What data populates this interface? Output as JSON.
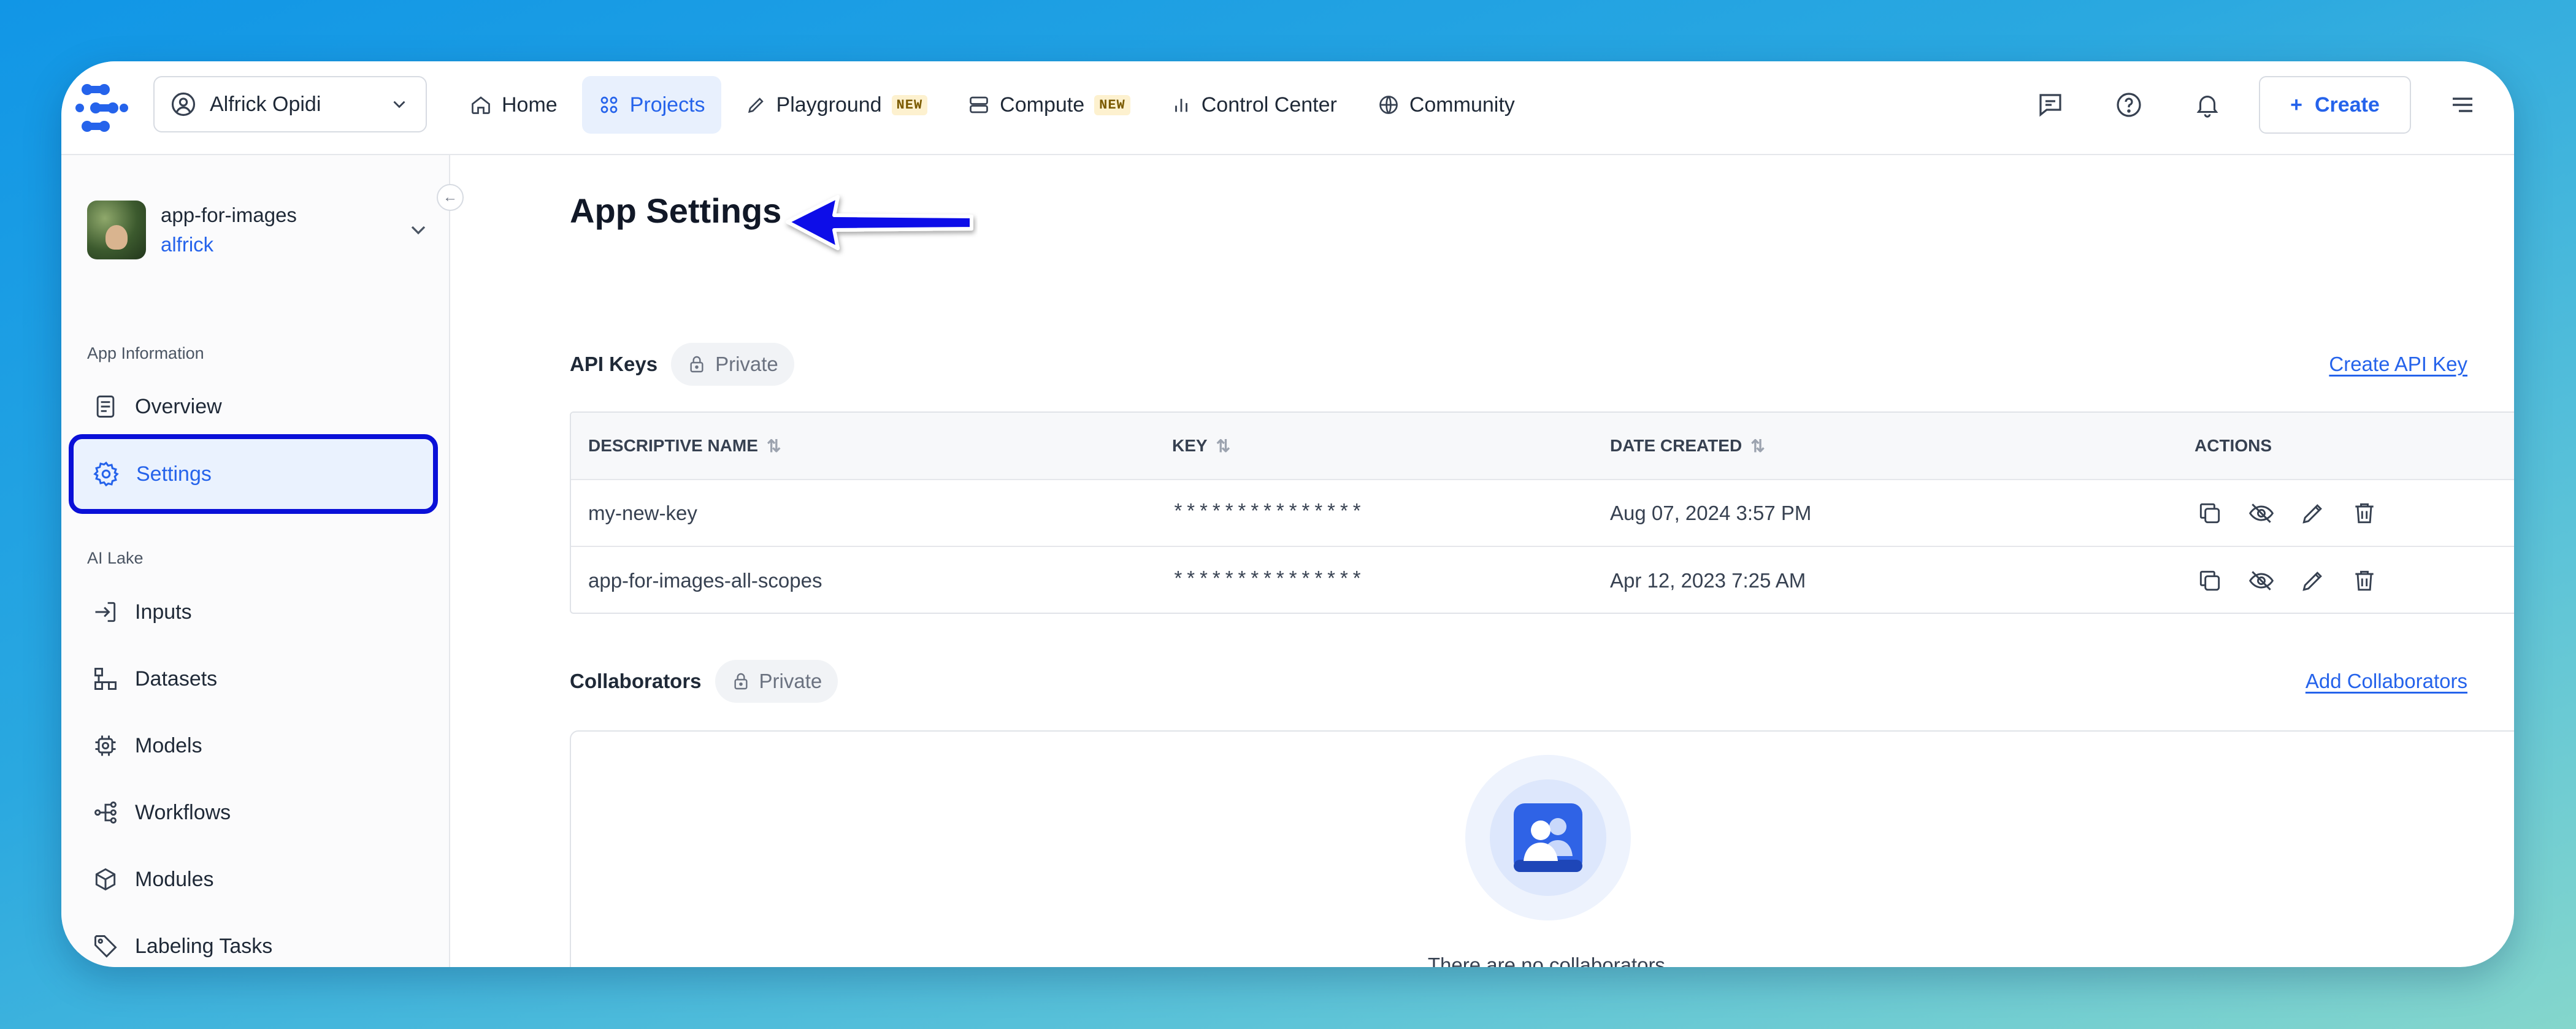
{
  "topbar": {
    "user_name": "Alfrick Opidi",
    "nav": [
      {
        "label": "Home"
      },
      {
        "label": "Projects"
      },
      {
        "label": "Playground",
        "badge": "NEW"
      },
      {
        "label": "Compute",
        "badge": "NEW"
      },
      {
        "label": "Control Center"
      },
      {
        "label": "Community"
      }
    ],
    "create_label": "Create"
  },
  "sidebar": {
    "app_name": "app-for-images",
    "app_user": "alfrick",
    "section_app_info": "App Information",
    "section_ai_lake": "AI Lake",
    "items": [
      {
        "label": "Overview"
      },
      {
        "label": "Settings"
      },
      {
        "label": "Inputs"
      },
      {
        "label": "Datasets"
      },
      {
        "label": "Models"
      },
      {
        "label": "Workflows"
      },
      {
        "label": "Modules"
      },
      {
        "label": "Labeling Tasks"
      }
    ]
  },
  "main": {
    "title": "App Settings",
    "api_keys": {
      "title": "API Keys",
      "privacy": "Private",
      "create_link": "Create API Key",
      "columns": [
        "DESCRIPTIVE NAME",
        "KEY",
        "DATE CREATED",
        "ACTIONS"
      ],
      "rows": [
        {
          "name": "my-new-key",
          "key": "***************",
          "date": "Aug 07, 2024 3:57 PM"
        },
        {
          "name": "app-for-images-all-scopes",
          "key": "***************",
          "date": "Apr 12, 2023 7:25 AM"
        }
      ]
    },
    "collaborators": {
      "title": "Collaborators",
      "privacy": "Private",
      "add_link": "Add Collaborators",
      "empty_text": "There are no collaborators."
    }
  },
  "colors": {
    "accent": "#2563eb",
    "highlight_border": "#0a10d8",
    "annotation_arrow": "#0a10e8"
  }
}
